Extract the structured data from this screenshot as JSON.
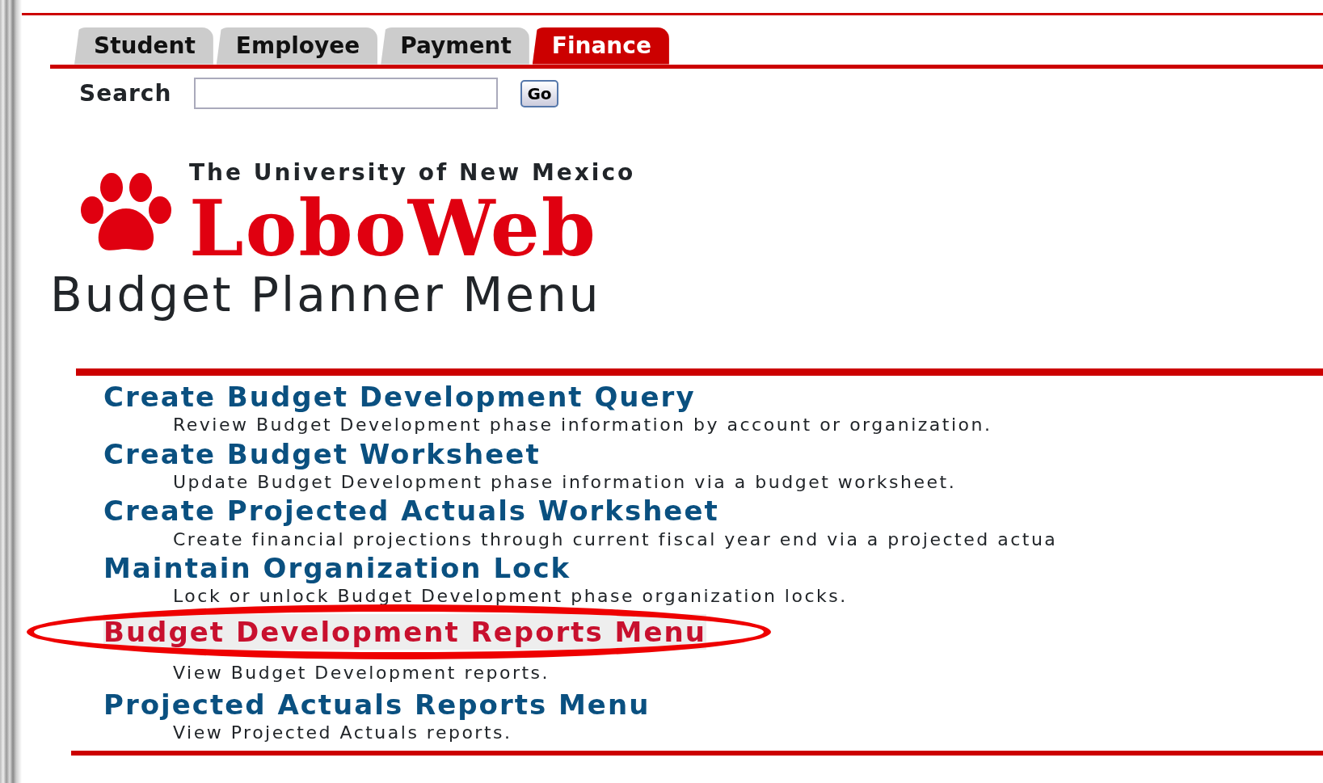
{
  "tabs": [
    {
      "label": "Student",
      "selected": false
    },
    {
      "label": "Employee",
      "selected": false
    },
    {
      "label": "Payment",
      "selected": false
    },
    {
      "label": "Finance",
      "selected": true
    }
  ],
  "search": {
    "label": "Search",
    "button": "Go"
  },
  "logo": {
    "line_1": "The University of New Mexico",
    "line_2": "LoboWeb"
  },
  "heading": "Budget Planner Menu",
  "menu_items": [
    {
      "title": "Create Budget Development Query",
      "description": "Review Budget Development phase information by account or organization.",
      "selected": false,
      "circled": false
    },
    {
      "title": "Create Budget Worksheet",
      "description": "Update Budget Development phase information via a budget worksheet.",
      "selected": false,
      "circled": false
    },
    {
      "title": "Create Projected Actuals Worksheet",
      "description": "Create financial projections through current fiscal year end via a projected actua",
      "selected": false,
      "circled": false
    },
    {
      "title": "Maintain Organization Lock",
      "description": "Lock or unlock Budget Development phase organization locks.",
      "selected": false,
      "circled": false
    },
    {
      "title": "Budget Development Reports Menu",
      "description": "View Budget Development reports.",
      "selected": true,
      "circled": true
    },
    {
      "title": "Projected Actuals Reports Menu",
      "description": "View Projected Actuals reports.",
      "selected": false,
      "circled": false
    }
  ]
}
